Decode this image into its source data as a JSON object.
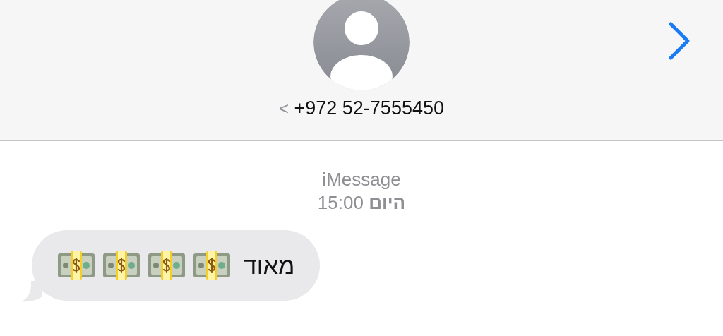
{
  "header": {
    "contact": "+972 52-7555450",
    "back_chevron": "<"
  },
  "conversation": {
    "service": "iMessage",
    "timestamp": "**היום** 15:00",
    "messages": [
      {
        "kind": "incoming",
        "text": "מאוד",
        "emojis": [
          {
            "kind": "banknote"
          },
          {
            "kind": "banknote"
          },
          {
            "kind": "banknote"
          },
          {
            "kind": "banknote"
          }
        ]
      }
    ]
  }
}
